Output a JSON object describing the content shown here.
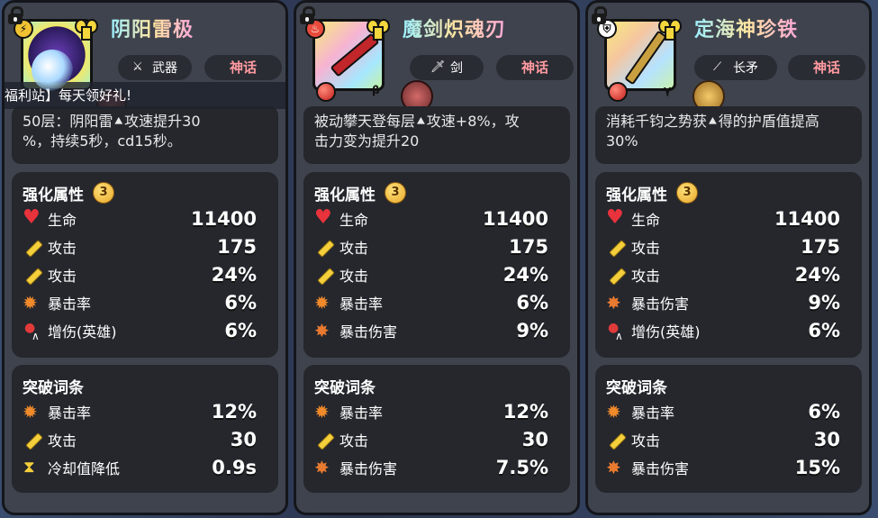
{
  "cards": [
    {
      "name": "阴阳雷极",
      "type_label": "武器",
      "tier_label": "神话",
      "badge_icon": "lightning-icon",
      "banner_text": "福利站】每天领好礼!",
      "desc_lines": [
        "50层：阴阳雷⯅攻速提升30",
        "%，持续5秒，cd15秒。"
      ],
      "enhance_title": "强化属性",
      "enhance_level": "3",
      "enhance_stats": [
        {
          "icon": "heart-icon",
          "label": "生命",
          "value": "11400"
        },
        {
          "icon": "sword-icon",
          "label": "攻击",
          "value": "175"
        },
        {
          "icon": "sword-icon",
          "label": "攻击",
          "value": "24%"
        },
        {
          "icon": "flame-icon",
          "label": "暴击率",
          "value": "6%"
        },
        {
          "icon": "hero-damage-icon",
          "label": "增伤(英雄)",
          "value": "6%"
        }
      ],
      "break_title": "突破词条",
      "break_stats": [
        {
          "icon": "flame-icon",
          "label": "暴击率",
          "value": "12%"
        },
        {
          "icon": "sword-icon",
          "label": "攻击",
          "value": "30"
        },
        {
          "icon": "cooldown-icon",
          "label": "冷却值降低",
          "value": "0.9s"
        }
      ]
    },
    {
      "name": "魔剑炽魂刃",
      "type_label": "剑",
      "tier_label": "神话",
      "badge_icon": "fire-icon",
      "greek": "β",
      "desc_lines": [
        "被动攀天登每层⯅攻速+8%，攻",
        "击力变为提升20"
      ],
      "enhance_title": "强化属性",
      "enhance_level": "3",
      "enhance_stats": [
        {
          "icon": "heart-icon",
          "label": "生命",
          "value": "11400"
        },
        {
          "icon": "sword-icon",
          "label": "攻击",
          "value": "175"
        },
        {
          "icon": "sword-icon",
          "label": "攻击",
          "value": "24%"
        },
        {
          "icon": "flame-icon",
          "label": "暴击率",
          "value": "6%"
        },
        {
          "icon": "burst-icon",
          "label": "暴击伤害",
          "value": "9%"
        }
      ],
      "break_title": "突破词条",
      "break_stats": [
        {
          "icon": "flame-icon",
          "label": "暴击率",
          "value": "12%"
        },
        {
          "icon": "sword-icon",
          "label": "攻击",
          "value": "30"
        },
        {
          "icon": "burst-icon",
          "label": "暴击伤害",
          "value": "7.5%"
        }
      ]
    },
    {
      "name": "定海神珍铁",
      "type_label": "长矛",
      "tier_label": "神话",
      "badge_icon": "shield-icon",
      "greek": "γ",
      "desc_lines": [
        "消耗千钧之势获⯅得的护盾值提高",
        "30%"
      ],
      "enhance_title": "强化属性",
      "enhance_level": "3",
      "enhance_stats": [
        {
          "icon": "heart-icon",
          "label": "生命",
          "value": "11400"
        },
        {
          "icon": "sword-icon",
          "label": "攻击",
          "value": "175"
        },
        {
          "icon": "sword-icon",
          "label": "攻击",
          "value": "24%"
        },
        {
          "icon": "burst-icon",
          "label": "暴击伤害",
          "value": "9%"
        },
        {
          "icon": "hero-damage-icon",
          "label": "增伤(英雄)",
          "value": "6%"
        }
      ],
      "break_title": "突破词条",
      "break_stats": [
        {
          "icon": "flame-icon",
          "label": "暴击率",
          "value": "6%"
        },
        {
          "icon": "sword-icon",
          "label": "攻击",
          "value": "30"
        },
        {
          "icon": "burst-icon",
          "label": "暴击伤害",
          "value": "15%"
        }
      ]
    }
  ]
}
